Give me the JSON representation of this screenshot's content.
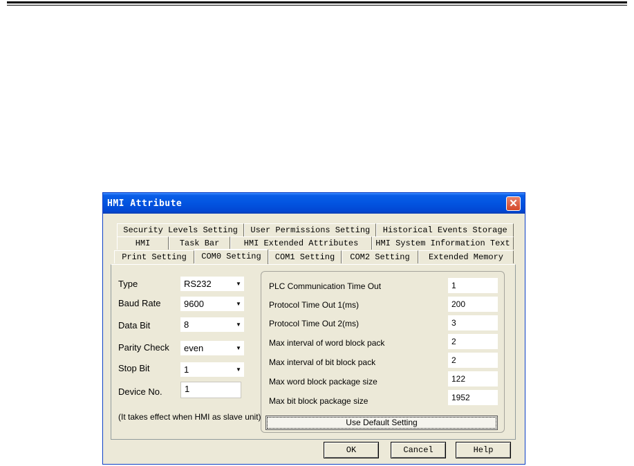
{
  "window": {
    "title": "HMI Attribute",
    "close_symbol": "✕"
  },
  "tabs": {
    "row1": [
      "Security Levels Setting",
      "User Permissions Setting",
      "Historical Events Storage"
    ],
    "row2": [
      "HMI",
      "Task Bar",
      "HMI Extended Attributes",
      "HMI System Information Text"
    ],
    "row3": [
      "Print Setting",
      "COM0 Setting",
      "COM1 Setting",
      "COM2 Setting",
      "Extended Memory"
    ]
  },
  "left": {
    "type_label": "Type",
    "type_value": "RS232",
    "baud_label": "Baud Rate",
    "baud_value": "9600",
    "databit_label": "Data Bit",
    "databit_value": "8",
    "parity_label": "Parity Check",
    "parity_value": "even",
    "stopbit_label": "Stop Bit",
    "stopbit_value": "1",
    "device_label": "Device No.",
    "device_value": "1",
    "note": "(It takes effect when HMI as slave unit)"
  },
  "right": {
    "rows": [
      {
        "label": "PLC Communication Time Out",
        "value": "1"
      },
      {
        "label": "Protocol Time Out 1(ms)",
        "value": "200"
      },
      {
        "label": "Protocol Time Out 2(ms)",
        "value": "3"
      },
      {
        "label": "Max interval of word block pack",
        "value": "2"
      },
      {
        "label": "Max interval of bit block pack",
        "value": "2"
      },
      {
        "label": "Max word block package size",
        "value": "122"
      },
      {
        "label": "Max bit block package size",
        "value": "1952"
      }
    ],
    "default_button": "Use Default Setting"
  },
  "buttons": {
    "ok": "OK",
    "cancel": "Cancel",
    "help": "Help"
  },
  "colors": {
    "titlebar": "#0254e0",
    "dialog_bg": "#ece9d8",
    "close": "#d3472a"
  }
}
